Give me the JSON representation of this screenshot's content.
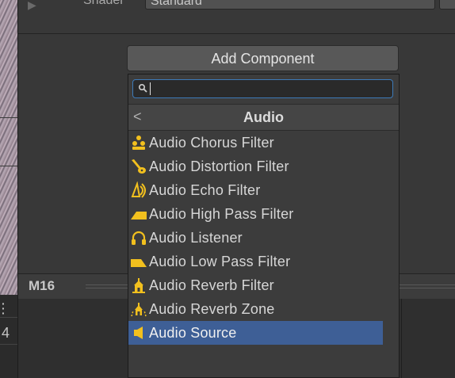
{
  "inspector": {
    "shader_label": "Shader",
    "shader_value": "Standard",
    "add_component_label": "Add Component"
  },
  "popup": {
    "search_value": "",
    "category_title": "Audio",
    "items": [
      {
        "label": "Audio Chorus Filter",
        "icon": "audio-chorus-filter-icon"
      },
      {
        "label": "Audio Distortion Filter",
        "icon": "audio-distortion-filter-icon"
      },
      {
        "label": "Audio Echo Filter",
        "icon": "audio-echo-filter-icon"
      },
      {
        "label": "Audio High Pass Filter",
        "icon": "audio-high-pass-filter-icon"
      },
      {
        "label": "Audio Listener",
        "icon": "audio-listener-icon"
      },
      {
        "label": "Audio Low Pass Filter",
        "icon": "audio-low-pass-filter-icon"
      },
      {
        "label": "Audio Reverb Filter",
        "icon": "audio-reverb-filter-icon"
      },
      {
        "label": "Audio Reverb Zone",
        "icon": "audio-reverb-zone-icon"
      },
      {
        "label": "Audio Source",
        "icon": "audio-source-icon",
        "selected": true
      }
    ]
  },
  "lower_panel": {
    "title": "M16"
  },
  "left_panel": {
    "number": "4"
  },
  "colors": {
    "selection": "#3e5f96",
    "icon_yellow": "#f2c01e",
    "search_focus": "#3d7ab8"
  }
}
